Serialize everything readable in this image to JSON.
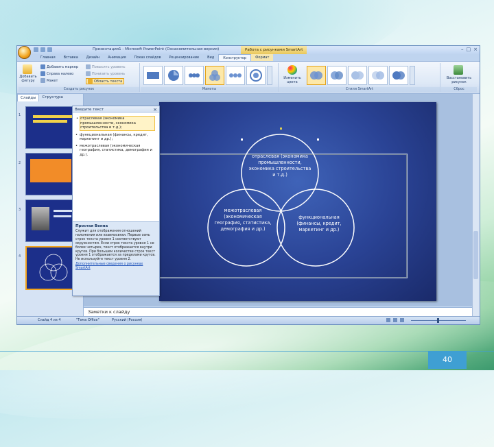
{
  "window": {
    "title": "Презентация1 - Microsoft PowerPoint (Ознакомительная версия)",
    "context_title": "Работа с рисунками SmartArt",
    "buttons": [
      "–",
      "□",
      "×"
    ]
  },
  "tabs": [
    "Главная",
    "Вставка",
    "Дизайн",
    "Анимация",
    "Показ слайдов",
    "Рецензирование",
    "Вид",
    "Конструктор",
    "Формат"
  ],
  "ribbon": {
    "group1": {
      "label": "Создать рисунок",
      "add_figure": "Добавить фигуру",
      "add_bullet": "Добавить маркер",
      "right_to_left": "Справа налево",
      "layout": "Макет",
      "promote": "Повысить уровень",
      "demote": "Понизить уровень",
      "text_pane": "Область текста"
    },
    "group2": {
      "label": "Макеты"
    },
    "group3": {
      "label": "Стили SmartArt",
      "change_colors": "Изменить цвета"
    },
    "group4": {
      "label": "Сброс",
      "reset": "Восстановить рисунок"
    }
  },
  "side_panel": {
    "tabs": [
      "Слайды",
      "Структура"
    ],
    "slide_numbers": [
      "1",
      "2",
      "3",
      "4"
    ]
  },
  "text_pane": {
    "title": "Введите текст",
    "close": "×",
    "items": [
      "отраслевая (экономика промышленности, экономика строительства и т.д.);",
      "функциональная (финансы, кредит, маркетинг и др.);",
      "межотраслевая (экономическая география, статистика, демография и др.)."
    ],
    "desc_title": "Простая Венна",
    "desc_text": "Служит для отображения отношений наложения или взаимосвязи. Первые семь строк текста уровня 1 соответствуют окружностям. Если строк текста уровня 1 не более четырех, текст отображается внутри кругов. При большем количестве строк текст уровня 1 отображается за пределами кругов. Не используйте текст уровня 2.",
    "desc_link": "Дополнительные сведения о рисунках SmartArt"
  },
  "diagram": {
    "circle_top": "отраслевая (экономика промышленности, экономика строительства и т.д.)",
    "circle_left": "межотраслевая (экономическая география, статистика, демография и др.)",
    "circle_right": "функциональная (финансы, кредит, маркетинг и др.)"
  },
  "notes_placeholder": "Заметки к слайду",
  "status": {
    "slide": "Слайд 4 из 4",
    "theme": "\"Тема Office\"",
    "lang": "Русский (Россия)"
  },
  "page_number": "40",
  "colors": {
    "slide_bg": "#2a4395",
    "accent_orange": "#f2a31b",
    "ribbon_blue": "#c9dcf3",
    "page_num_bg": "#3f9fd3"
  }
}
